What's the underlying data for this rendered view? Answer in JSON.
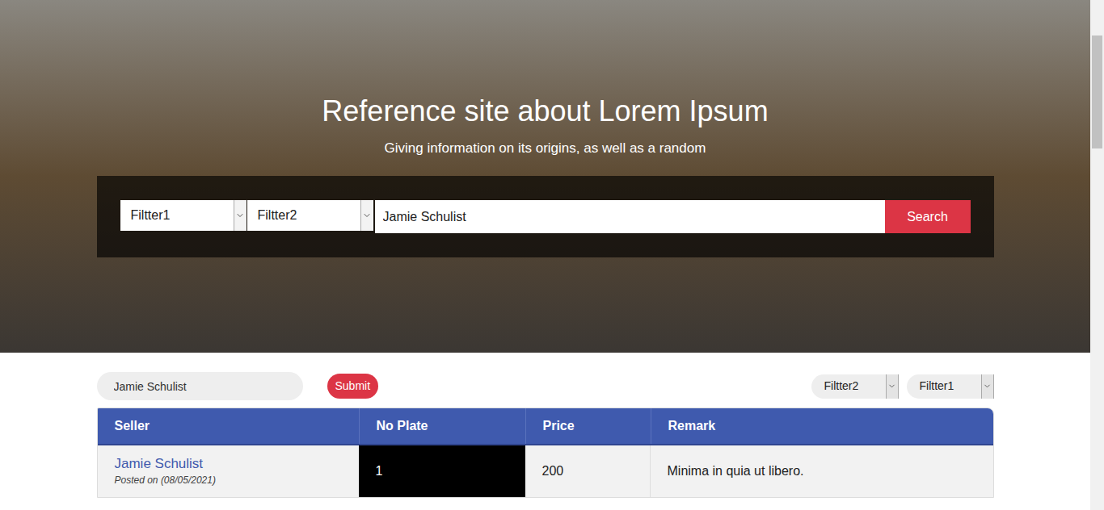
{
  "hero": {
    "title": "Reference site about Lorem Ipsum",
    "subtitle": "Giving information on its origins, as well as a random"
  },
  "search_panel": {
    "filters": [
      "Filtter1",
      "Filtter2"
    ],
    "query": "Jamie Schulist",
    "button": "Search"
  },
  "toolbar": {
    "query": "Jamie Schulist",
    "button": "Submit",
    "filters": [
      "Filtter2",
      "Filtter1"
    ]
  },
  "table": {
    "columns": [
      "Seller",
      "No Plate",
      "Price",
      "Remark"
    ],
    "rows": [
      {
        "seller": "Jamie Schulist",
        "posted": "Posted on (08/05/2021)",
        "plate": "1",
        "price": "200",
        "remark": "Minima in quia ut libero."
      }
    ]
  }
}
